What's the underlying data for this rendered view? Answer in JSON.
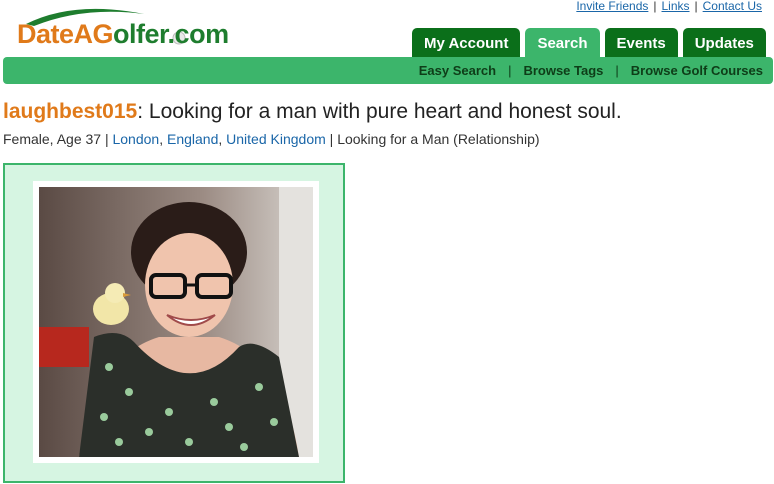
{
  "brand": {
    "logo_text_part1": "DateAG",
    "logo_text_o": "o",
    "logo_text_part2": "lfer.c",
    "logo_text_o2": "o",
    "logo_text_part3": "m",
    "green": "#1e7d2e",
    "orange": "#e07a1a"
  },
  "top_links": [
    "Invite Friends",
    "Links",
    "Contact Us"
  ],
  "tabs": [
    {
      "label": "My Account",
      "active": false
    },
    {
      "label": "Search",
      "active": true
    },
    {
      "label": "Events",
      "active": false
    },
    {
      "label": "Updates",
      "active": false
    }
  ],
  "subnav": [
    "Easy Search",
    "Browse Tags",
    "Browse Golf Courses"
  ],
  "profile": {
    "username": "laughbest015",
    "headline": ": Looking for a man with pure heart and honest soul.",
    "gender_age": "Female, Age 37 | ",
    "city": "London",
    "region": "England",
    "country": "United Kingdom",
    "seeking": " | Looking for a Man (Relationship)"
  },
  "colors": {
    "tab_dark": "#0b6f1a",
    "tab_active": "#3cb56b",
    "frame_bg": "#d6f5e2",
    "link": "#1a66a8"
  }
}
